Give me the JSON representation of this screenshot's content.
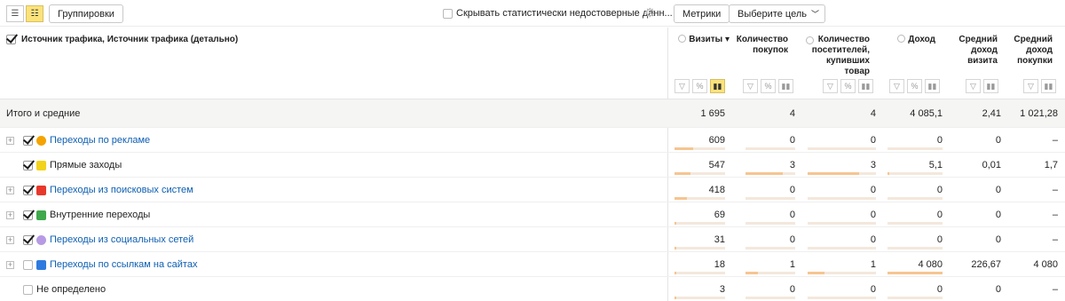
{
  "toolbar": {
    "groupings_label": "Группировки",
    "hide_unreliable_label": "Скрывать статистически недостоверные данн...",
    "metrics_label": "Метрики",
    "goal_label": "Выберите цель"
  },
  "header": {
    "dimension_title": "Источник трафика, Источник трафика (детально)",
    "columns": [
      {
        "label": "Визиты",
        "sorted": "▾"
      },
      {
        "label": "Количество покупок"
      },
      {
        "label": "Количество посетителей, купивших товар"
      },
      {
        "label": "Доход"
      },
      {
        "label": "Средний доход визита"
      },
      {
        "label": "Средний доход покупки"
      }
    ]
  },
  "totals": {
    "label": "Итого и средние",
    "values": [
      "1 695",
      "4",
      "4",
      "4 085,1",
      "2,41",
      "1 021,28"
    ]
  },
  "rows": [
    {
      "name": "Переходы по рекламе",
      "link": true,
      "checked": true,
      "expandable": true,
      "icon_color": "#f4a300",
      "icon": "ad-icon",
      "values": [
        "609",
        "0",
        "0",
        "0",
        "0",
        "–"
      ],
      "share": [
        0.36,
        0,
        0,
        0,
        0,
        0
      ]
    },
    {
      "name": "Прямые заходы",
      "link": false,
      "checked": true,
      "expandable": false,
      "icon_color": "#f2d21b",
      "icon": "direct-icon",
      "values": [
        "547",
        "3",
        "3",
        "5,1",
        "0,01",
        "1,7"
      ],
      "share": [
        0.32,
        0.75,
        0.75,
        0.0012,
        0.0041,
        0.0017
      ]
    },
    {
      "name": "Переходы из поисковых систем",
      "link": true,
      "checked": true,
      "expandable": true,
      "icon_color": "#e8372b",
      "icon": "search-icon",
      "values": [
        "418",
        "0",
        "0",
        "0",
        "0",
        "–"
      ],
      "share": [
        0.25,
        0,
        0,
        0,
        0,
        0
      ]
    },
    {
      "name": "Внутренние переходы",
      "link": false,
      "checked": true,
      "expandable": true,
      "icon_color": "#3ea84b",
      "icon": "home-icon",
      "values": [
        "69",
        "0",
        "0",
        "0",
        "0",
        "–"
      ],
      "share": [
        0.04,
        0,
        0,
        0,
        0,
        0
      ]
    },
    {
      "name": "Переходы из социальных сетей",
      "link": true,
      "checked": true,
      "expandable": true,
      "icon_color": "#b79ae4",
      "icon": "social-icon",
      "values": [
        "31",
        "0",
        "0",
        "0",
        "0",
        "–"
      ],
      "share": [
        0.02,
        0,
        0,
        0,
        0,
        0
      ]
    },
    {
      "name": "Переходы по ссылкам на сайтах",
      "link": true,
      "checked": false,
      "expandable": true,
      "icon_color": "#2e7be0",
      "icon": "link-icon",
      "values": [
        "18",
        "1",
        "1",
        "4 080",
        "226,67",
        "4 080"
      ],
      "share": [
        0.01,
        0.25,
        0.25,
        0.9988,
        0.94,
        0.998
      ]
    },
    {
      "name": "Не определено",
      "link": false,
      "checked": false,
      "expandable": false,
      "icon_color": "",
      "icon": "",
      "values": [
        "3",
        "0",
        "0",
        "0",
        "0",
        "–"
      ],
      "share": [
        0.002,
        0,
        0,
        0,
        0,
        0
      ]
    }
  ]
}
